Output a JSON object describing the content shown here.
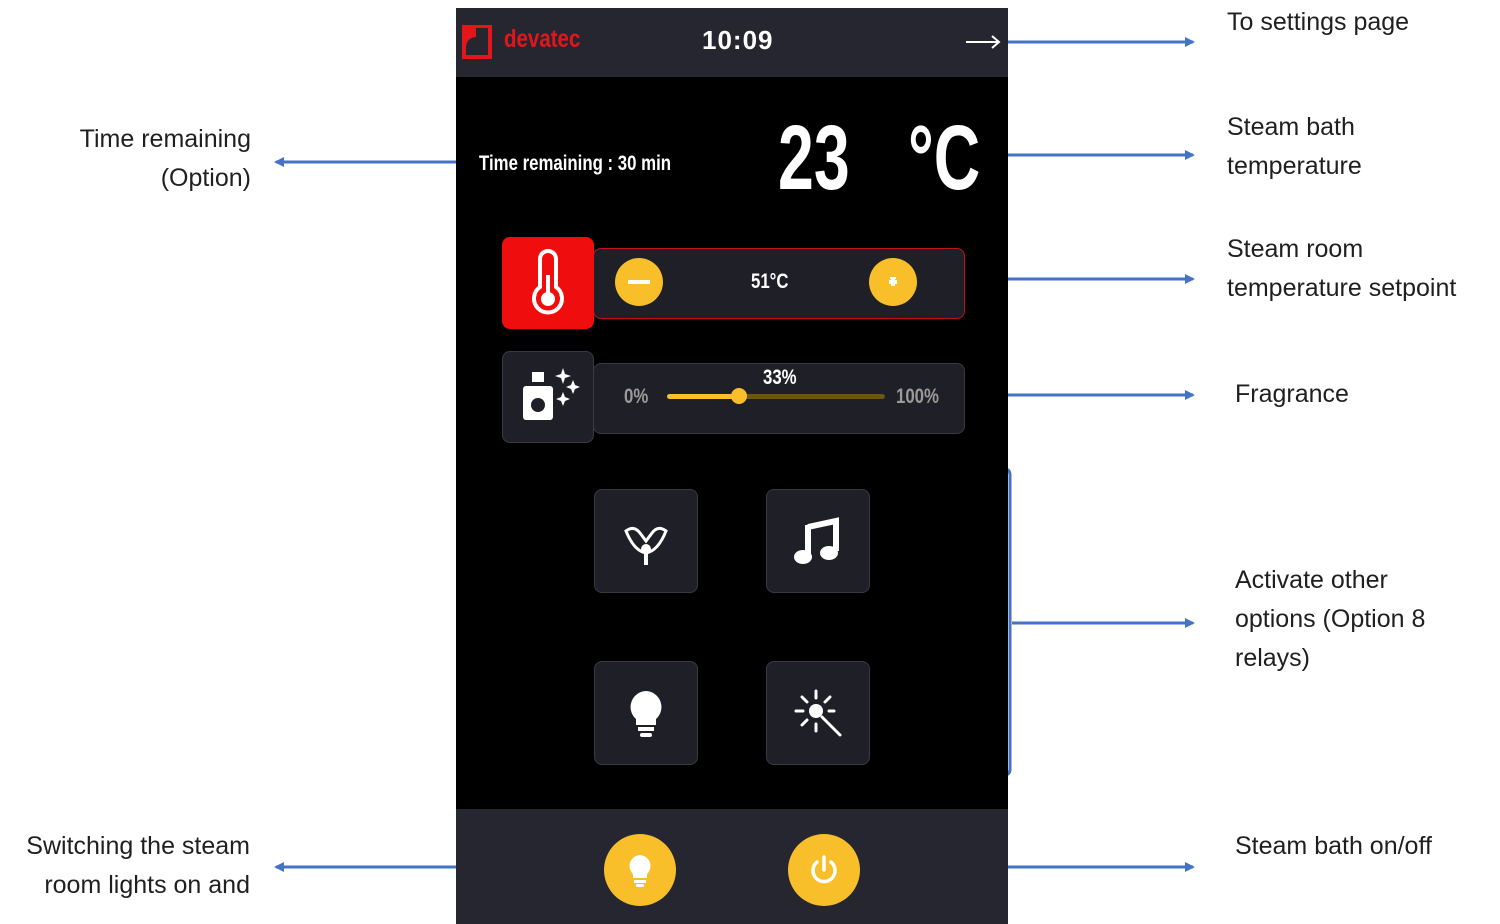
{
  "device": {
    "brand": "devatec",
    "clock": "10:09",
    "time_remaining": "Time remaining : 30 min",
    "temperature": {
      "value": "23",
      "unit": "°C"
    },
    "setpoint": {
      "value": "51°C"
    },
    "fragrance": {
      "value_label": "33%",
      "min_label": "0%",
      "max_label": "100%",
      "level": 0.33
    },
    "options": [
      {
        "icon": "inhaler-mask-icon"
      },
      {
        "icon": "music-note-icon"
      },
      {
        "icon": "lightbulb-icon"
      },
      {
        "icon": "sun-wand-icon"
      }
    ],
    "bottom": {
      "light_icon": "lightbulb-icon",
      "power_icon": "power-icon"
    }
  },
  "annotations": {
    "settings": "To settings page",
    "time_remaining": [
      "Time remaining",
      "(Option)"
    ],
    "bath_temp": [
      "Steam bath",
      "temperature"
    ],
    "setpoint": [
      "Steam room",
      "temperature setpoint"
    ],
    "fragrance": "Fragrance",
    "options": [
      "Activate other",
      "options (Option 8",
      "relays)"
    ],
    "lights": [
      "Switching the steam",
      "room lights on and"
    ],
    "power": "Steam bath on/off"
  },
  "colors": {
    "accent": "#f9bf2a",
    "brand_red": "#e4161b",
    "arrow": "#4472c4"
  }
}
